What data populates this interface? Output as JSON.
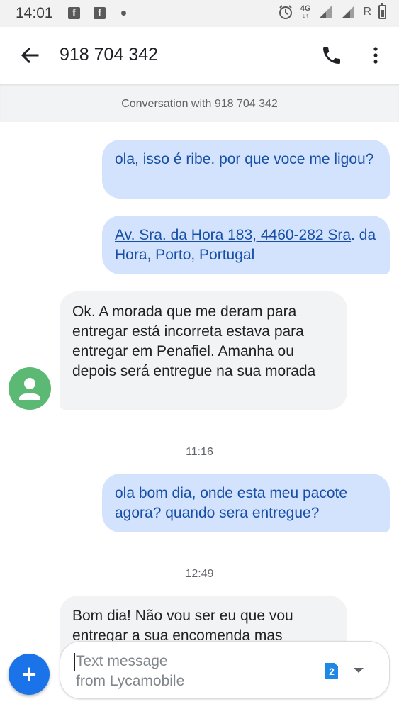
{
  "status_bar": {
    "time": "14:01",
    "network": "4G",
    "roaming": "R"
  },
  "app_bar": {
    "title": "918 704 342"
  },
  "conversation": {
    "header": "Conversation with 918 704 342",
    "messages": [
      {
        "direction": "outgoing",
        "text": "ola, isso é ribe. por que voce me ligou?"
      },
      {
        "direction": "outgoing",
        "link_part": "Av. Sra. da Hora 183, 4460-282 Sra",
        "rest_part": ". da Hora, Porto, Portugal"
      },
      {
        "direction": "incoming",
        "text": "Ok. A morada que me deram para entregar está incorreta estava para entregar em Penafiel. Amanha ou depois será entregue na sua morada"
      },
      {
        "direction": "outgoing",
        "text": "ola bom dia, onde esta meu pacote agora? quando sera entregue?"
      },
      {
        "direction": "incoming",
        "text": "Bom dia! Não vou ser eu que vou entregar a sua encomenda mas"
      }
    ],
    "timestamps": [
      "11:16",
      "12:49"
    ]
  },
  "compose": {
    "placeholder_line1": "Text message",
    "placeholder_line2": "from Lycamobile",
    "sim_number": "2"
  },
  "colors": {
    "outgoing_bubble": "#d3e3fd",
    "outgoing_text": "#174ea6",
    "incoming_bubble": "#f1f3f4",
    "avatar": "#5bb974",
    "fab": "#1a73e8"
  }
}
